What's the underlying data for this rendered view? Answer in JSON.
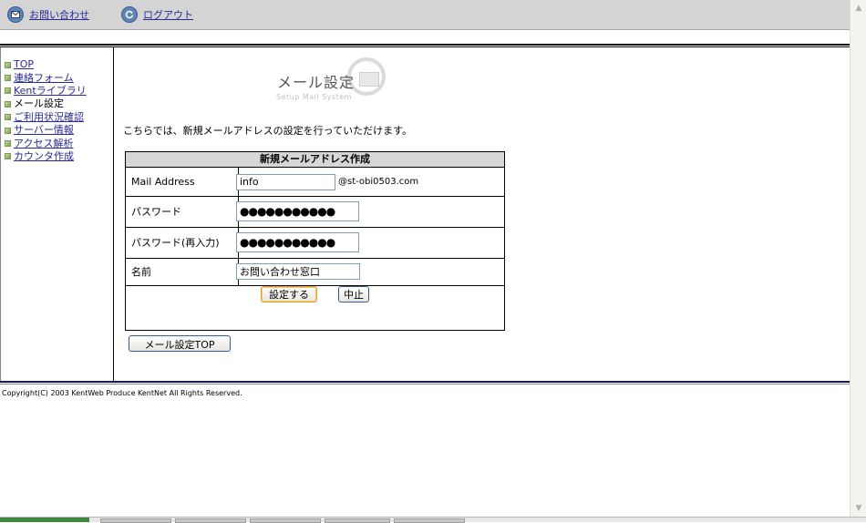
{
  "toolbar": {
    "contact_label": "お問い合わせ",
    "logout_label": "ログアウト"
  },
  "sidebar": {
    "items": [
      {
        "label": "TOP"
      },
      {
        "label": "連絡フォーム"
      },
      {
        "label": "Kentライブラリ"
      },
      {
        "label": "メール設定"
      },
      {
        "label": "ご利用状況確認"
      },
      {
        "label": "サーバー情報"
      },
      {
        "label": "アクセス解析"
      },
      {
        "label": "カウンタ作成"
      }
    ]
  },
  "header": {
    "title": "メール設定",
    "subtitle": "Setup Mail System"
  },
  "intro_text": "こちらでは、新規メールアドレスの設定を行っていただけます。",
  "form": {
    "heading": "新規メールアドレス作成",
    "mail_label": "Mail Address",
    "mail_value": "info",
    "domain": "@st-obi0503.com",
    "password_label": "パスワード",
    "password_value": "●●●●●●●●●●●",
    "password_confirm_label": "パスワード(再入力)",
    "password_confirm_value": "●●●●●●●●●●●",
    "name_label": "名前",
    "name_value": "お問い合わせ窓口",
    "submit_label": "設定する",
    "cancel_label": "中止"
  },
  "back_button_label": "メール設定TOP",
  "footer": {
    "copyright": "Copyright(C) 2003 KentWeb Produce KentNet All Rights Reserved."
  }
}
